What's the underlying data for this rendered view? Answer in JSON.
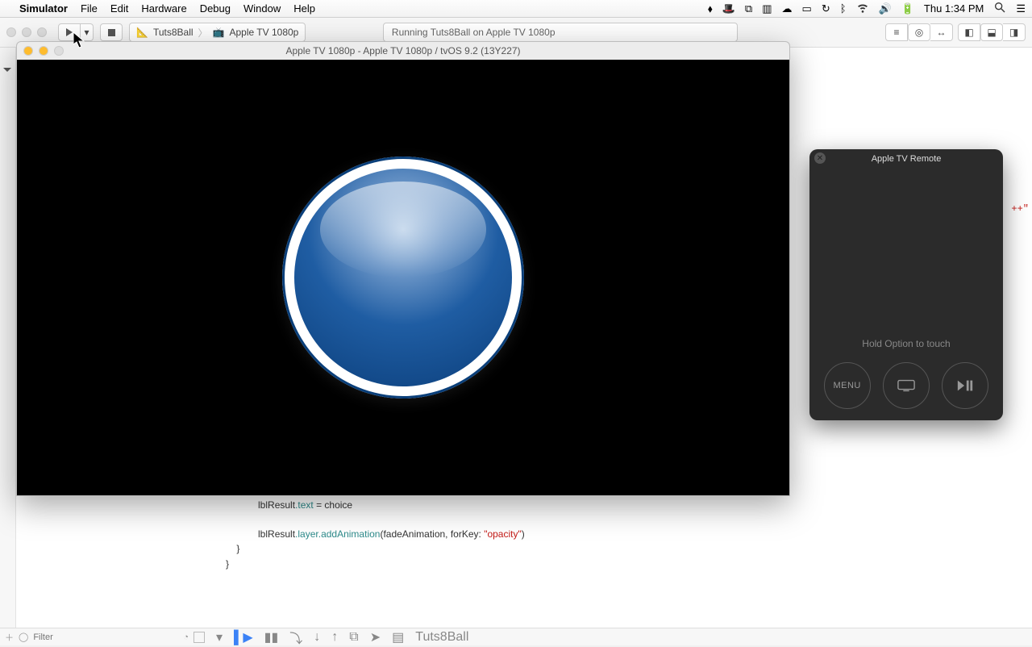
{
  "menubar": {
    "app": "Simulator",
    "items": [
      "File",
      "Edit",
      "Hardware",
      "Debug",
      "Window",
      "Help"
    ],
    "clock": "Thu 1:34 PM"
  },
  "xcode": {
    "scheme_project": "Tuts8Ball",
    "scheme_device": "Apple TV 1080p",
    "status": "Running Tuts8Ball on Apple TV 1080p",
    "filter_placeholder": "Filter",
    "debug_target": "Tuts8Ball",
    "error_flag": "++\""
  },
  "simulator": {
    "title": "Apple TV 1080p - Apple TV 1080p / tvOS 9.2 (13Y227)"
  },
  "remote": {
    "title": "Apple TV Remote",
    "hint": "Hold Option to touch",
    "menu_label": "MENU"
  },
  "code": {
    "line1_a": "lblResult",
    "line1_b": ".text",
    "line1_c": " = choice",
    "line2_a": "lblResult",
    "line2_b": ".layer",
    "line2_c": ".addAnimation",
    "line2_d": "(fadeAnimation, forKey: ",
    "line2_str": "\"opacity\"",
    "line2_e": ")",
    "line3": "    }",
    "line4": "}"
  }
}
